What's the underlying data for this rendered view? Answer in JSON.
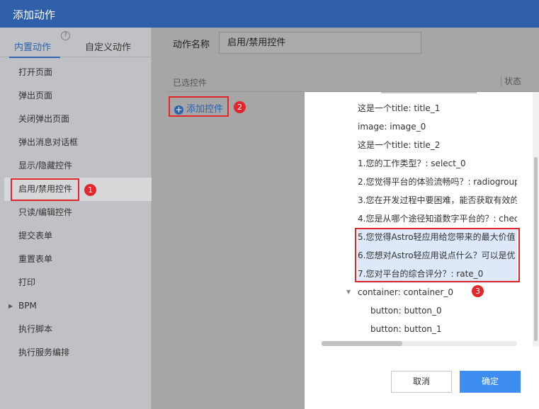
{
  "header": {
    "title": "添加动作"
  },
  "left_panel": {
    "tabs": [
      {
        "label": "内置动作"
      },
      {
        "label": "自定义动作"
      }
    ],
    "help_glyph": "?",
    "menu": [
      {
        "label": "打开页面"
      },
      {
        "label": "弹出页面"
      },
      {
        "label": "关闭弹出页面"
      },
      {
        "label": "弹出消息对话框"
      },
      {
        "label": "显示/隐藏控件"
      },
      {
        "label": "启用/禁用控件"
      },
      {
        "label": "只读/编辑控件"
      },
      {
        "label": "提交表单"
      },
      {
        "label": "重置表单"
      },
      {
        "label": "打印"
      },
      {
        "label": "BPM"
      },
      {
        "label": "执行脚本"
      },
      {
        "label": "执行服务编排"
      }
    ],
    "active_menu": "启用/禁用控件"
  },
  "main": {
    "action_name_label": "动作名称",
    "action_name_value": "启用/禁用控件",
    "columns": {
      "selected": "已选控件",
      "status": "状态"
    },
    "add_control_label": "添加控件"
  },
  "annotations": [
    "1",
    "2",
    "3"
  ],
  "dialog": {
    "tree_items": [
      {
        "label": "这是一个title: title_1"
      },
      {
        "label": "image: image_0"
      },
      {
        "label": "这是一个title: title_2"
      },
      {
        "label": "1.您的工作类型？: select_0"
      },
      {
        "label": "2.您觉得平台的体验流畅吗？: radiogroup"
      },
      {
        "label": "3.您在开发过程中要困难，能否获取有效的"
      },
      {
        "label": "4.您是从哪个途径知道数字平台的？: chec"
      },
      {
        "label": "5.您觉得Astro轻应用给您带来的最大价值"
      },
      {
        "label": "6.您想对Astro轻应用说点什么？可以是优"
      },
      {
        "label": "7.您对平台的综合评分？: rate_0"
      },
      {
        "label": "container: container_0"
      },
      {
        "label": "button: button_0"
      },
      {
        "label": "button: button_1"
      }
    ],
    "cancel_label": "取消",
    "ok_label": "确定"
  },
  "colors": {
    "header": "#2f5fa8",
    "accent": "#2a64b2",
    "annotation_red": "#e2262b",
    "ok_button": "#3d8ef0",
    "highlight": "#dde8f8"
  }
}
